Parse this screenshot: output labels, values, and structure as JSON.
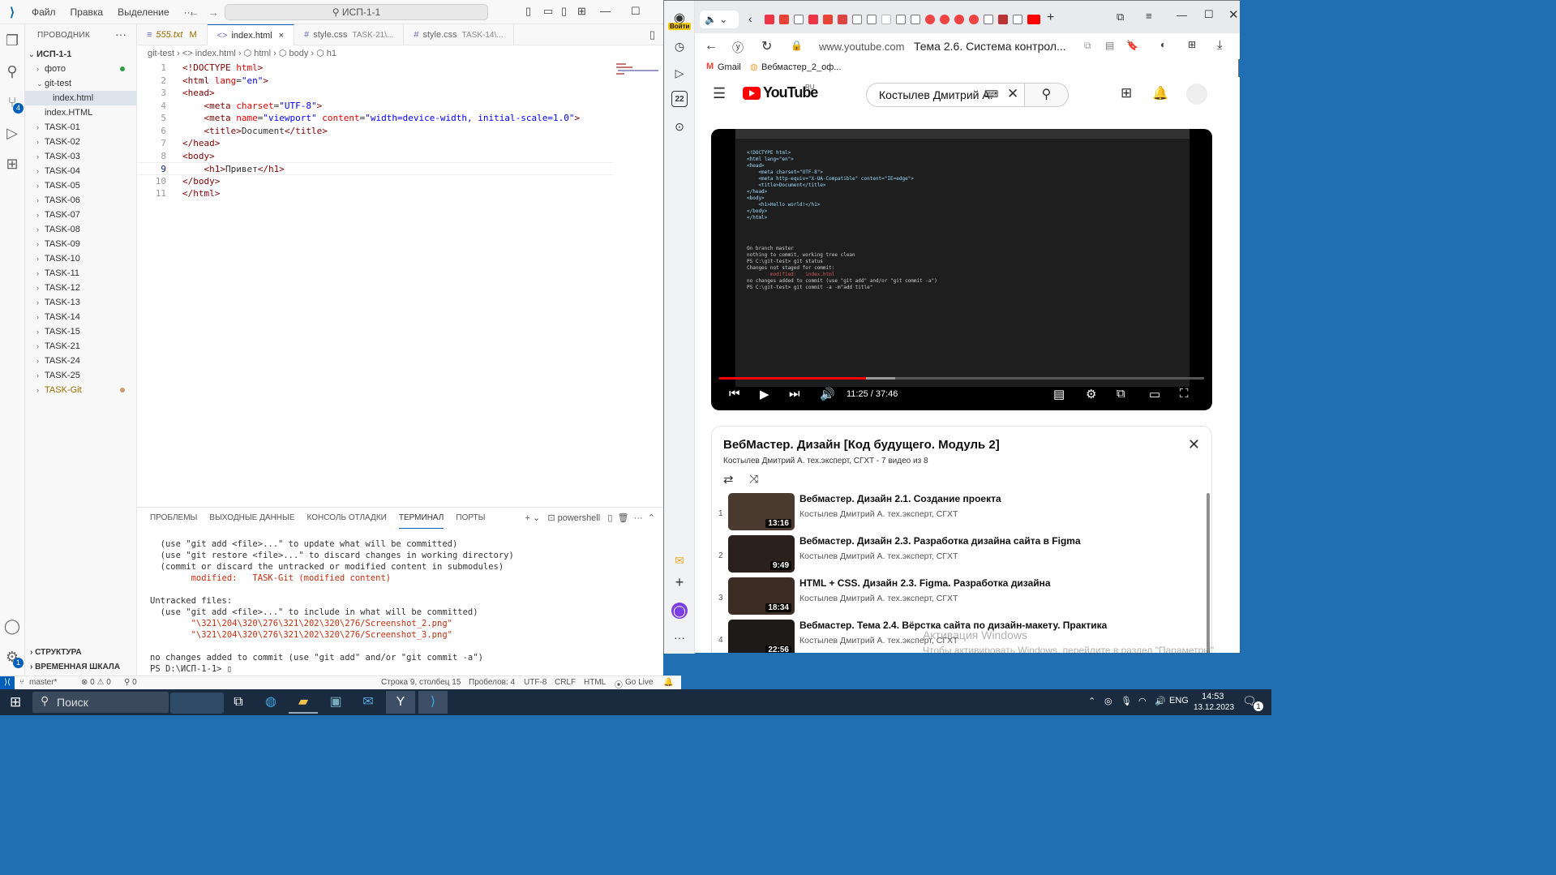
{
  "vscode": {
    "menu": [
      "Файл",
      "Правка",
      "Выделение",
      "···"
    ],
    "search": "ИСП-1-1",
    "explorer_title": "ПРОВОДНИК",
    "root": "ИСП-1-1",
    "tree": [
      {
        "label": "фото",
        "indent": 1,
        "chev": "›",
        "dot": "#2ea043"
      },
      {
        "label": "git-test",
        "indent": 1,
        "chev": "⌄"
      },
      {
        "label": "index.html",
        "indent": 2,
        "chev": "",
        "selected": true
      },
      {
        "label": "index.HTML",
        "indent": 1,
        "chev": ""
      },
      {
        "label": "TASK-01",
        "indent": 1,
        "chev": "›"
      },
      {
        "label": "TASK-02",
        "indent": 1,
        "chev": "›"
      },
      {
        "label": "TASK-03",
        "indent": 1,
        "chev": "›"
      },
      {
        "label": "TASK-04",
        "indent": 1,
        "chev": "›"
      },
      {
        "label": "TASK-05",
        "indent": 1,
        "chev": "›"
      },
      {
        "label": "TASK-06",
        "indent": 1,
        "chev": "›"
      },
      {
        "label": "TASK-07",
        "indent": 1,
        "chev": "›"
      },
      {
        "label": "TASK-08",
        "indent": 1,
        "chev": "›"
      },
      {
        "label": "TASK-09",
        "indent": 1,
        "chev": "›"
      },
      {
        "label": "TASK-10",
        "indent": 1,
        "chev": "›"
      },
      {
        "label": "TASK-11",
        "indent": 1,
        "chev": "›"
      },
      {
        "label": "TASK-12",
        "indent": 1,
        "chev": "›"
      },
      {
        "label": "TASK-13",
        "indent": 1,
        "chev": "›"
      },
      {
        "label": "TASK-14",
        "indent": 1,
        "chev": "›"
      },
      {
        "label": "TASK-15",
        "indent": 1,
        "chev": "›"
      },
      {
        "label": "TASK-21",
        "indent": 1,
        "chev": "›"
      },
      {
        "label": "TASK-24",
        "indent": 1,
        "chev": "›"
      },
      {
        "label": "TASK-25",
        "indent": 1,
        "chev": "›"
      },
      {
        "label": "TASK-Git",
        "indent": 1,
        "chev": "›",
        "dot": "#cc9a6f",
        "color": "#9a6e00"
      }
    ],
    "outline": "СТРУКТУРА",
    "timeline": "ВРЕМЕННАЯ ШКАЛА",
    "tabs": [
      {
        "label": "555.txt",
        "mod": "M",
        "active": false,
        "icon": "≡"
      },
      {
        "label": "index.html",
        "mod": "",
        "active": true,
        "icon": "<>",
        "close": "×"
      },
      {
        "label": "style.css",
        "sub": "TASK-21\\...",
        "active": false,
        "icon": "#"
      },
      {
        "label": "style.css",
        "sub": "TASK-14\\...",
        "active": false,
        "icon": "#"
      }
    ],
    "breadcrumb": "git-test  ›  <> index.html  ›  ⬡ html  ›  ⬡ body  ›  ⬡ h1",
    "code": [
      {
        "n": "1",
        "html": "<span class='t-tag'>&lt;!DOCTYPE</span> <span class='t-attr'>html</span><span class='t-tag'>&gt;</span>"
      },
      {
        "n": "2",
        "html": "<span class='t-tag'>&lt;html</span> <span class='t-attr'>lang</span>=<span class='t-val'>\"en\"</span><span class='t-tag'>&gt;</span>"
      },
      {
        "n": "3",
        "html": "<span class='t-tag'>&lt;head&gt;</span>"
      },
      {
        "n": "4",
        "html": "    <span class='t-tag'>&lt;meta</span> <span class='t-attr'>charset</span>=<span class='t-val'>\"UTF-8\"</span><span class='t-tag'>&gt;</span>"
      },
      {
        "n": "5",
        "html": "    <span class='t-tag'>&lt;meta</span> <span class='t-attr'>name</span>=<span class='t-val'>\"viewport\"</span> <span class='t-attr'>content</span>=<span class='t-val'>\"width=device-width, initial-scale=1.0\"</span><span class='t-tag'>&gt;</span>"
      },
      {
        "n": "6",
        "html": "    <span class='t-tag'>&lt;title&gt;</span>Document<span class='t-tag'>&lt;/title&gt;</span>"
      },
      {
        "n": "7",
        "html": "<span class='t-tag'>&lt;/head&gt;</span>"
      },
      {
        "n": "8",
        "html": "<span class='t-tag'>&lt;body&gt;</span>"
      },
      {
        "n": "9",
        "html": "    <span class='t-tag'>&lt;h1&gt;</span>Привет<span class='t-tag'>&lt;/h1&gt;</span>",
        "cur": true
      },
      {
        "n": "10",
        "html": "<span class='t-tag'>&lt;/body&gt;</span>"
      },
      {
        "n": "11",
        "html": "<span class='t-tag'>&lt;/html&gt;</span>"
      }
    ],
    "panel_tabs": [
      "ПРОБЛЕМЫ",
      "ВЫХОДНЫЕ ДАННЫЕ",
      "КОНСОЛЬ ОТЛАДКИ",
      "ТЕРМИНАЛ",
      "ПОРТЫ"
    ],
    "panel_active": "ТЕРМИНАЛ",
    "panel_shell": "powershell",
    "terminal": [
      {
        "t": "  (use \"git add <file>...\" to update what will be committed)"
      },
      {
        "t": "  (use \"git restore <file>...\" to discard changes in working directory)"
      },
      {
        "t": "  (commit or discard the untracked or modified content in submodules)"
      },
      {
        "t": "        modified:   TASK-Git (modified content)",
        "red": true
      },
      {
        "t": ""
      },
      {
        "t": "Untracked files:"
      },
      {
        "t": "  (use \"git add <file>...\" to include in what will be committed)"
      },
      {
        "t": "        \"\\321\\204\\320\\276\\321\\202\\320\\276/Screenshot_2.png\"",
        "red": true
      },
      {
        "t": "        \"\\321\\204\\320\\276\\321\\202\\320\\276/Screenshot_3.png\"",
        "red": true
      },
      {
        "t": ""
      },
      {
        "t": "no changes added to commit (use \"git add\" and/or \"git commit -a\")"
      },
      {
        "t": "PS D:\\ИСП-1-1> ▯"
      }
    ],
    "status": {
      "branch": "master*",
      "problems": "⊗ 0 ⚠ 0",
      "ports": "⚲ 0",
      "position": "Строка 9, столбец 15",
      "spaces": "Пробелов: 4",
      "encoding": "UTF-8",
      "eol": "CRLF",
      "lang": "HTML",
      "golive": "Go Live"
    }
  },
  "browser": {
    "login": "Войти",
    "url": "www.youtube.com",
    "page_title": "Тема 2.6. Система контрол...",
    "bookmarks": [
      "Gmail",
      "Вебмастер_2_оф..."
    ],
    "side_badge": "22",
    "yt": {
      "region": "RU",
      "search_value": "Костылев Дмитрий А.",
      "time": "11:25 / 37:46",
      "progress": 0.303,
      "playlist_title": "ВебМастер. Дизайн [Код будущего. Модуль 2]",
      "playlist_sub": "Костылев Дмитрий А. тех.эксперт, СГХТ - 7 видео из 8",
      "items": [
        {
          "idx": "1",
          "title": "Вебмастер. Дизайн 2.1. Создание проекта",
          "author": "Костылев Дмитрий А. тех.эксперт, СГХТ",
          "dur": "13:16"
        },
        {
          "idx": "2",
          "title": "Вебмастер. Дизайн 2.3. Разработка дизайна сайта в Figma",
          "author": "Костылев Дмитрий А. тех.эксперт, СГХТ",
          "dur": "9:49"
        },
        {
          "idx": "3",
          "title": "HTML + CSS. Дизайн 2.3. Figma. Разработка дизайна",
          "author": "Костылев Дмитрий А. тех.эксперт, СГХТ",
          "dur": "18:34"
        },
        {
          "idx": "4",
          "title": "Вебмастер. Тема 2.4. Вёрстка сайта по дизайн-макету. Практика",
          "author": "Костылев Дмитрий А. тех.эксперт, СГХТ",
          "dur": "22:56"
        }
      ]
    }
  },
  "watermark": {
    "line1": "Активация Windows",
    "line2": "Чтобы активировать Windows, перейдите в раздел \"Параметры\"."
  },
  "taskbar": {
    "search": "Поиск",
    "lang": "ENG",
    "time": "14:53",
    "date": "13.12.2023",
    "notif": "1"
  }
}
